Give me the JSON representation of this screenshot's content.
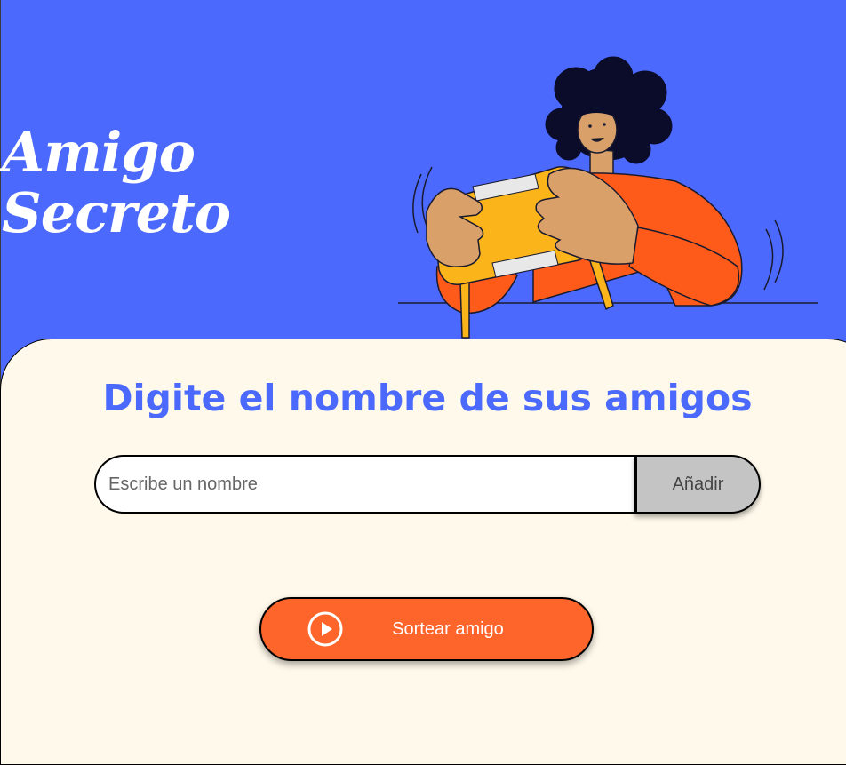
{
  "header": {
    "title_line1": "Amigo",
    "title_line2": "Secreto"
  },
  "main": {
    "subtitle": "Digite el nombre de sus amigos",
    "name_input": {
      "placeholder": "Escribe un nombre",
      "value": ""
    },
    "add_button_label": "Añadir",
    "draw_button_label": "Sortear amigo"
  },
  "icons": {
    "draw_button_icon": "play-circle-icon"
  },
  "colors": {
    "header_background": "#4B69FD",
    "panel_background": "#FFF9EB",
    "accent_orange": "#FE652B",
    "subtitle_blue": "#4B69FD",
    "add_button_gray": "#C4C4C4"
  }
}
